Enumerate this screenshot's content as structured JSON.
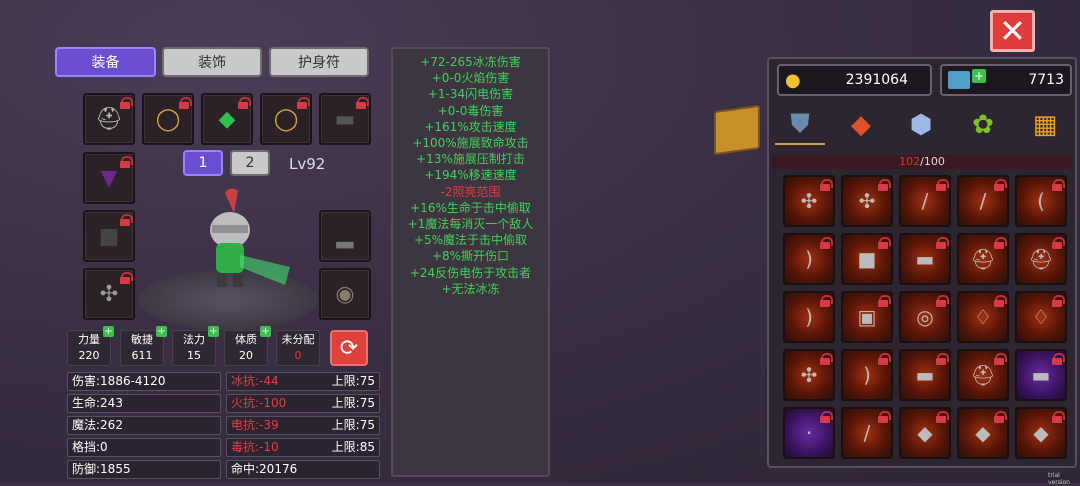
{
  "tabs": [
    {
      "label": "装备",
      "active": true
    },
    {
      "label": "装饰",
      "active": false
    },
    {
      "label": "护身符",
      "active": false
    }
  ],
  "pages": [
    "1",
    "2"
  ],
  "level": "Lv92",
  "stats": [
    {
      "name": "力量",
      "value": "220"
    },
    {
      "name": "敏捷",
      "value": "611"
    },
    {
      "name": "法力",
      "value": "15"
    },
    {
      "name": "体质",
      "value": "20"
    },
    {
      "name": "未分配",
      "value": "0"
    }
  ],
  "attributes": [
    {
      "left": "伤害:1886-4120",
      "mid": "冰抗:-44",
      "cap": "上限:75"
    },
    {
      "left": "生命:243",
      "mid": "火抗:-100",
      "cap": "上限:75"
    },
    {
      "left": "魔法:262",
      "mid": "电抗:-39",
      "cap": "上限:75"
    },
    {
      "left": "格挡:0",
      "mid": "毒抗:-10",
      "cap": "上限:85"
    },
    {
      "left": "防御:1855",
      "mid": "命中:20176",
      "cap": ""
    }
  ],
  "effects": [
    {
      "text": "+72-265冰冻伤害",
      "color": "#3fd25a"
    },
    {
      "text": "+0-0火焰伤害",
      "color": "#3fd25a"
    },
    {
      "text": "+1-34闪电伤害",
      "color": "#3fd25a"
    },
    {
      "text": "+0-0毒伤害",
      "color": "#3fd25a"
    },
    {
      "text": "+161%攻击速度",
      "color": "#3fd25a"
    },
    {
      "text": "+100%施展致命攻击",
      "color": "#3fd25a"
    },
    {
      "text": "+13%施展压制打击",
      "color": "#3fd25a"
    },
    {
      "text": "+194%移速速度",
      "color": "#3fd25a"
    },
    {
      "text": "-2照亮范围",
      "color": "#e04040"
    },
    {
      "text": "+16%生命于击中偷取",
      "color": "#3fd25a"
    },
    {
      "text": "+1魔法每消灭一个敌人",
      "color": "#3fd25a"
    },
    {
      "text": "+5%魔法于击中偷取",
      "color": "#3fd25a"
    },
    {
      "text": "+8%撕开伤口",
      "color": "#3fd25a"
    },
    {
      "text": "+24反伤电伤于攻击者",
      "color": "#3fd25a"
    },
    {
      "text": "+无法冰冻",
      "color": "#3fd25a"
    }
  ],
  "currency": {
    "gold": "2391064",
    "gems": "7713"
  },
  "inventory": {
    "count": "102",
    "max": "/100"
  },
  "watermark": "trial version",
  "icons": {
    "close": "close-x-icon",
    "reset": "refresh-icon",
    "gold": "gold-coins-icon",
    "gem": "video-ticket-icon",
    "box": "treasure-box-icon"
  }
}
